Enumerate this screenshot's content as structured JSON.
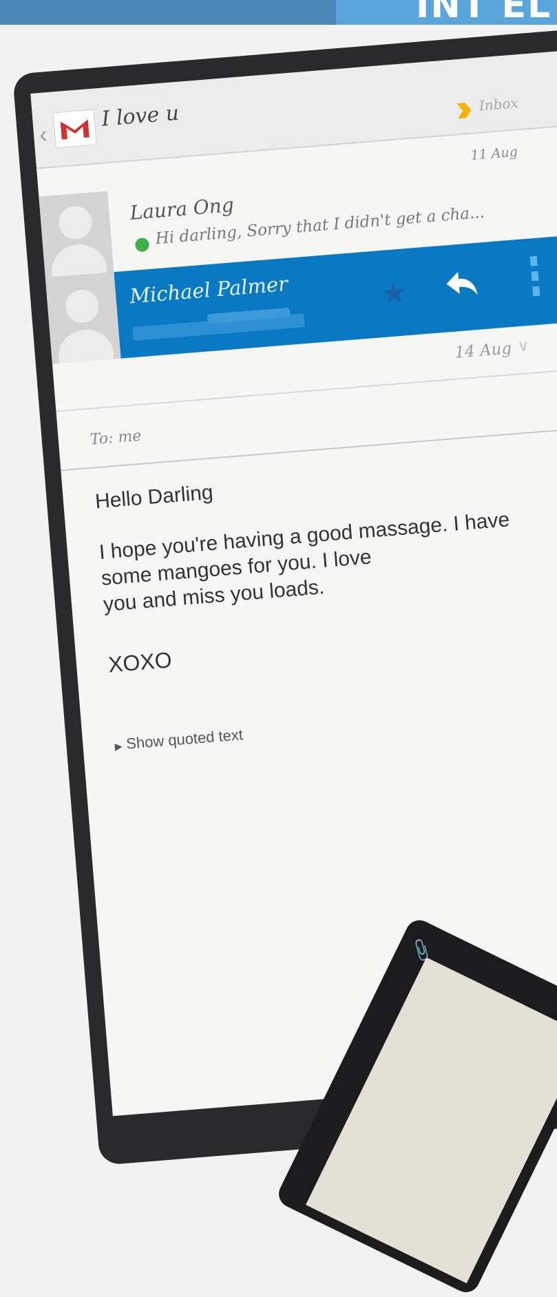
{
  "banner": {
    "letters": "INT EL"
  },
  "email": {
    "subject": "I love u",
    "label": "Inbox",
    "colors": {
      "selected_row": "#0a79c4",
      "unread_dot": "#3fae49",
      "gmail_red": "#d32f2f",
      "label_yellow": "#f4b400"
    }
  },
  "thread": [
    {
      "sender": "Laura Ong",
      "date": "11 Aug",
      "snippet": "Hi darling, Sorry that I didn't get a cha..."
    },
    {
      "sender": "Michael Palmer",
      "date": "14 Aug"
    }
  ],
  "message": {
    "to": "To: me",
    "greeting": "Hello Darling",
    "body_lines": [
      "I hope you're having a good massage. I have",
      "some mangoes for you. I love",
      "you and miss you loads."
    ],
    "signoff": "XOXO",
    "show_quoted": "Show quoted text"
  },
  "icons": {
    "back": "back-arrow-icon",
    "gmail": "gmail-icon",
    "label": "label-tag-icon",
    "star": "star-icon",
    "reply": "reply-icon",
    "overflow": "overflow-menu-icon",
    "expand": "chevron-down-icon",
    "attach": "paperclip-icon"
  }
}
